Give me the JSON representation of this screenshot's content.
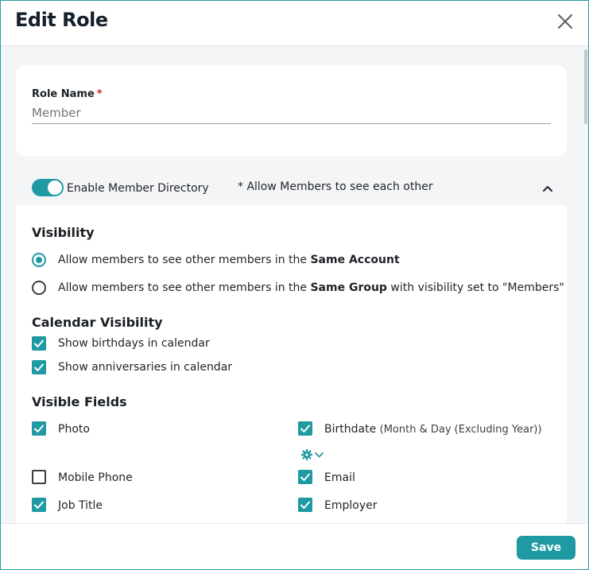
{
  "dialog": {
    "title": "Edit Role",
    "close_icon": "close-icon"
  },
  "role": {
    "label": "Role Name",
    "required_mark": "*",
    "placeholder": "Member"
  },
  "directory": {
    "toggle_on": true,
    "toggle_label": "Enable Member Directory",
    "note": "* Allow Members to see each other",
    "collapse_icon": "chevron-up-icon"
  },
  "visibility": {
    "title": "Visibility",
    "options": [
      {
        "prefix": "Allow members to see other members in the ",
        "bold": "Same Account",
        "suffix": "",
        "selected": true
      },
      {
        "prefix": "Allow members to see other members in the ",
        "bold": "Same Group",
        "suffix": " with visibility set to \"Members\"",
        "selected": false
      }
    ]
  },
  "calendar": {
    "title": "Calendar Visibility",
    "items": [
      {
        "label": "Show birthdays in calendar",
        "checked": true
      },
      {
        "label": "Show anniversaries in calendar",
        "checked": true
      }
    ]
  },
  "fields": {
    "title": "Visible Fields",
    "left": [
      {
        "label": "Photo",
        "checked": true
      },
      {
        "label": "Mobile Phone",
        "checked": false
      },
      {
        "label": "Job Title",
        "checked": true
      }
    ],
    "right": [
      {
        "label": "Birthdate",
        "note": "(Month & Day (Excluding Year))",
        "checked": true
      },
      {
        "label": "Email",
        "checked": true
      },
      {
        "label": "Employer",
        "checked": true
      }
    ],
    "settings_icon": "gear-icon"
  },
  "footer": {
    "save_label": "Save"
  },
  "colors": {
    "accent": "#1f9aa3",
    "required": "#d0281b"
  }
}
